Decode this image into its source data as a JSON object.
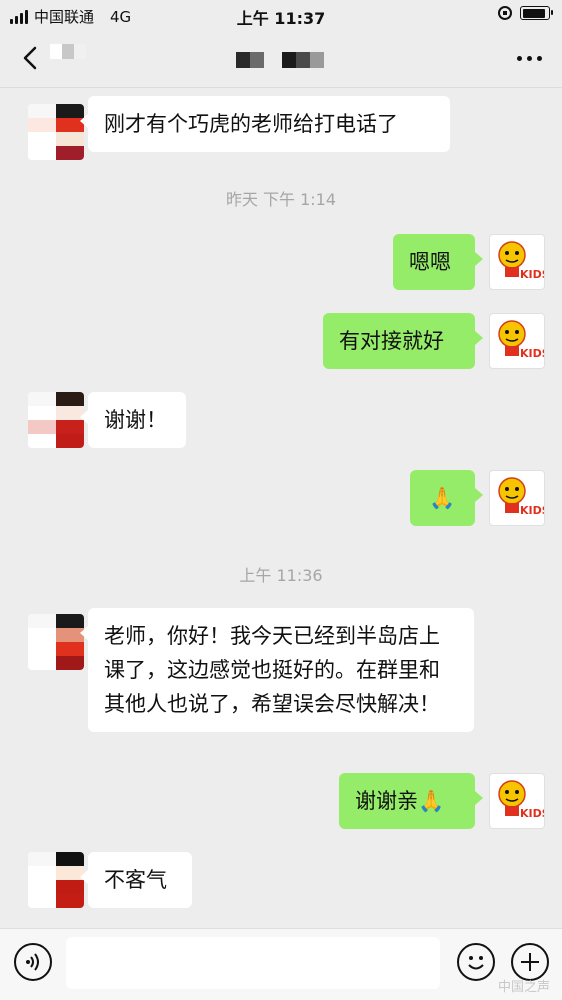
{
  "status_bar": {
    "carrier": "中国联通",
    "network": "4G",
    "time": "上午 11:37"
  },
  "nav": {
    "back_icon": "chevron-left-icon",
    "more_icon": "more-dots-icon"
  },
  "messages": [
    {
      "side": "in",
      "text": "刚才有个巧虎的老师给打电话了"
    },
    {
      "type": "time",
      "text": "昨天 下午 1:14"
    },
    {
      "side": "out",
      "text": "嗯嗯"
    },
    {
      "side": "out",
      "text": "有对接就好"
    },
    {
      "side": "in",
      "text": "谢谢！"
    },
    {
      "side": "out",
      "text": "🙏"
    },
    {
      "type": "time",
      "text": "上午 11:36"
    },
    {
      "side": "in",
      "text": "老师，你好！我今天已经到半岛店上课了，这边感觉也挺好的。在群里和其他人也说了，希望误会尽快解决！"
    },
    {
      "side": "out",
      "text": "谢谢亲🙏"
    },
    {
      "side": "in",
      "text": "不客气"
    }
  ],
  "avatar_self": {
    "logo_text": "KIDS"
  },
  "bottom_bar": {
    "voice_icon": "voice-icon",
    "emoji_icon": "emoji-icon",
    "plus_icon": "plus-icon"
  },
  "watermark": "中国之声",
  "colors": {
    "background": "#ededed",
    "out_bubble": "#95ec69",
    "in_bubble": "#ffffff",
    "timestamp": "#a6a6a6"
  }
}
